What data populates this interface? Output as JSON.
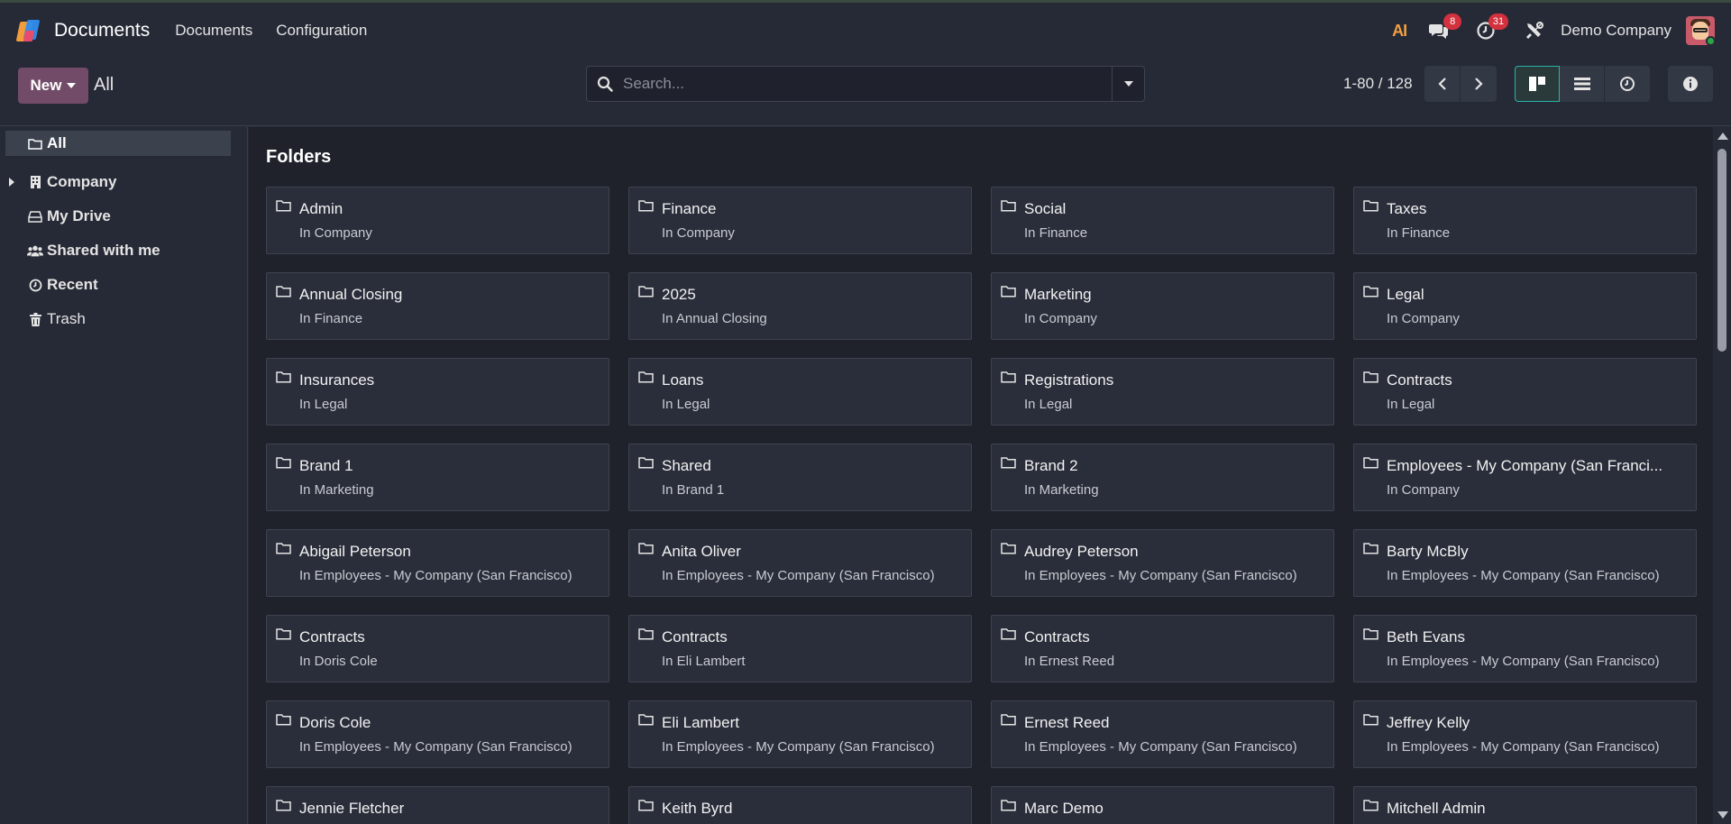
{
  "navbar": {
    "app_name": "Documents",
    "menu": [
      "Documents",
      "Configuration"
    ],
    "ai_label": "AI",
    "messages_count": "8",
    "activities_count": "31",
    "company": "Demo Company"
  },
  "control": {
    "new_label": "New",
    "breadcrumb": "All",
    "search_placeholder": "Search...",
    "pager": "1-80 / 128"
  },
  "sidebar": {
    "items": [
      {
        "label": "All"
      },
      {
        "label": "Company"
      },
      {
        "label": "My Drive"
      },
      {
        "label": "Shared with me"
      },
      {
        "label": "Recent"
      },
      {
        "label": "Trash"
      }
    ]
  },
  "main": {
    "section_title": "Folders",
    "folders": [
      {
        "name": "Admin",
        "location": "In Company"
      },
      {
        "name": "Finance",
        "location": "In Company"
      },
      {
        "name": "Social",
        "location": "In Finance"
      },
      {
        "name": "Taxes",
        "location": "In Finance"
      },
      {
        "name": "Annual Closing",
        "location": "In Finance"
      },
      {
        "name": "2025",
        "location": "In Annual Closing"
      },
      {
        "name": "Marketing",
        "location": "In Company"
      },
      {
        "name": "Legal",
        "location": "In Company"
      },
      {
        "name": "Insurances",
        "location": "In Legal"
      },
      {
        "name": "Loans",
        "location": "In Legal"
      },
      {
        "name": "Registrations",
        "location": "In Legal"
      },
      {
        "name": "Contracts",
        "location": "In Legal"
      },
      {
        "name": "Brand 1",
        "location": "In Marketing"
      },
      {
        "name": "Shared",
        "location": "In Brand 1"
      },
      {
        "name": "Brand 2",
        "location": "In Marketing"
      },
      {
        "name": "Employees - My Company (San Franci...",
        "location": "In Company"
      },
      {
        "name": "Abigail Peterson",
        "location": "In Employees - My Company (San Francisco)"
      },
      {
        "name": "Anita Oliver",
        "location": "In Employees - My Company (San Francisco)"
      },
      {
        "name": "Audrey Peterson",
        "location": "In Employees - My Company (San Francisco)"
      },
      {
        "name": "Barty McBly",
        "location": "In Employees - My Company (San Francisco)"
      },
      {
        "name": "Contracts",
        "location": "In Doris Cole"
      },
      {
        "name": "Contracts",
        "location": "In Eli Lambert"
      },
      {
        "name": "Contracts",
        "location": "In Ernest Reed"
      },
      {
        "name": "Beth Evans",
        "location": "In Employees - My Company (San Francisco)"
      },
      {
        "name": "Doris Cole",
        "location": "In Employees - My Company (San Francisco)"
      },
      {
        "name": "Eli Lambert",
        "location": "In Employees - My Company (San Francisco)"
      },
      {
        "name": "Ernest Reed",
        "location": "In Employees - My Company (San Francisco)"
      },
      {
        "name": "Jeffrey Kelly",
        "location": "In Employees - My Company (San Francisco)"
      },
      {
        "name": "Jennie Fletcher",
        "location": ""
      },
      {
        "name": "Keith Byrd",
        "location": ""
      },
      {
        "name": "Marc Demo",
        "location": ""
      },
      {
        "name": "Mitchell Admin",
        "location": ""
      }
    ]
  }
}
